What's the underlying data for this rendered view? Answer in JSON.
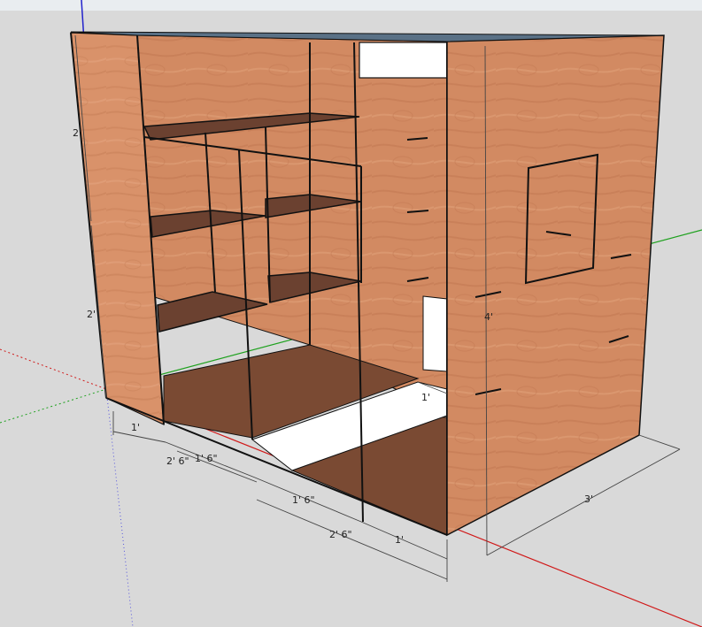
{
  "app": {
    "view": "3D model viewport",
    "colors": {
      "background": "#d9d9d9",
      "top_bar": "#e9edf0",
      "wood_light": "#d9926a",
      "wood_mid": "#c97f56",
      "floor_dark": "#7a4a33",
      "shelf_dark": "#6b4130",
      "top_edge": "#5a7186",
      "axis_red": "#d01818",
      "axis_green": "#1ea11e",
      "axis_blue": "#2222cc",
      "outline": "#111111",
      "opening": "#ffffff"
    }
  },
  "dimensions": {
    "left_upper_height": "2'",
    "left_lower_height": "2'",
    "total_height": "4'",
    "depth": "3'",
    "front_1": "1'",
    "front_2": "2' 6\"",
    "front_3": "1' 6\"",
    "front_4": "1' 6\"",
    "front_5": "2' 6\"",
    "front_6": "1'",
    "opening_width": "1'"
  }
}
